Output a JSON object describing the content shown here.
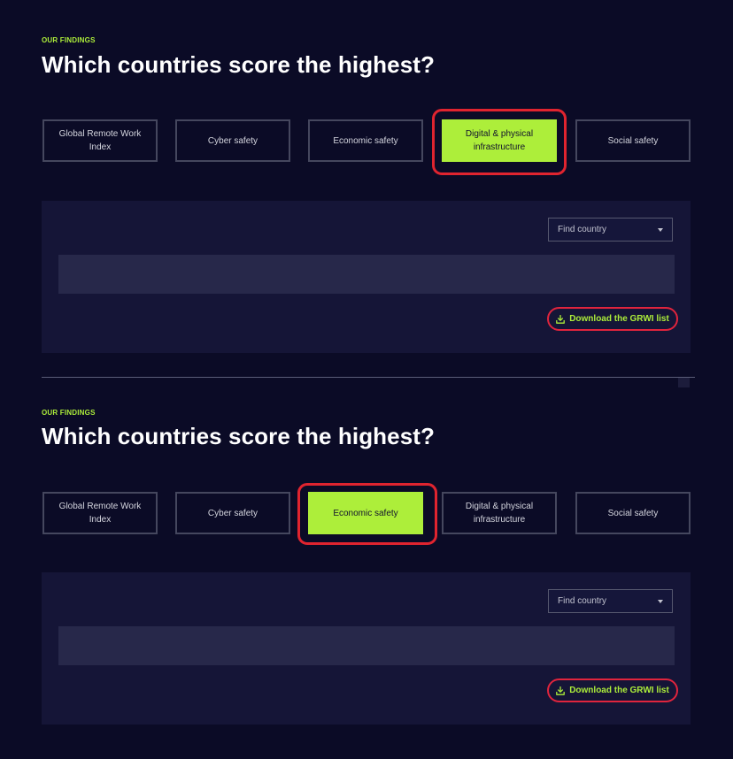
{
  "sections": [
    {
      "eyebrow": "OUR FINDINGS",
      "heading": "Which countries score the highest?",
      "tabs": [
        {
          "label": "Global Remote Work Index",
          "active": false
        },
        {
          "label": "Cyber safety",
          "active": false
        },
        {
          "label": "Economic safety",
          "active": false
        },
        {
          "label": "Digital & physical infrastructure",
          "active": true
        },
        {
          "label": "Social safety",
          "active": false
        }
      ],
      "find_country": "Find country",
      "download_label": "Download the GRWI list"
    },
    {
      "eyebrow": "OUR FINDINGS",
      "heading": "Which countries score the highest?",
      "tabs": [
        {
          "label": "Global Remote Work Index",
          "active": false
        },
        {
          "label": "Cyber safety",
          "active": false
        },
        {
          "label": "Economic safety",
          "active": true
        },
        {
          "label": "Digital & physical infrastructure",
          "active": false
        },
        {
          "label": "Social safety",
          "active": false
        }
      ],
      "find_country": "Find country",
      "download_label": "Download the GRWI list"
    }
  ],
  "icons": {
    "download": "download-icon",
    "caret": "chevron-down-icon"
  },
  "colors": {
    "background": "#0b0b26",
    "panel": "#151537",
    "accent_green": "#adee3a",
    "highlight_red": "#e0242f",
    "tab_border": "#45475e"
  }
}
